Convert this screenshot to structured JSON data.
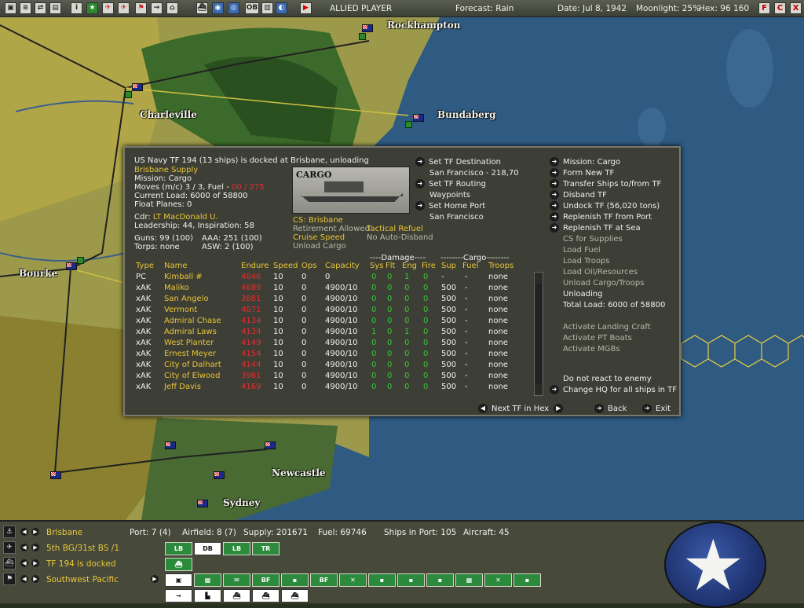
{
  "topbar": {
    "icons": [
      "save-icon",
      "report-icon",
      "swap-icon",
      "doc-icon",
      "info-icon",
      "star-icon",
      "plane-icon",
      "airplane-icon",
      "flag-icon",
      "transport-icon",
      "boat-icon",
      "ship-icon",
      "globe-icon",
      "globe2-icon",
      "ob-icon",
      "doc2-icon",
      "photo-icon",
      "play-icon"
    ],
    "ob_label": "OB",
    "side": "ALLIED PLAYER",
    "forecast": "Forecast: Rain",
    "date": "Date: Jul 8, 1942",
    "moonlight": "Moonlight: 25%",
    "hex": "Hex: 96 160",
    "right_buttons": [
      "F",
      "C",
      "X"
    ]
  },
  "map": {
    "cities": [
      "Rockhampton",
      "Charleville",
      "Bundaberg",
      "Bourke",
      "Newcastle",
      "Sydney"
    ]
  },
  "panel": {
    "title": "US Navy TF 194 (13 ships) is docked at Brisbane, unloading",
    "subtitle": "Brisbane Supply",
    "mission": "Mission: Cargo",
    "moves_prefix": "Moves (m/c) 3 / 3, Fuel - ",
    "moves_fuel": "00 / 275",
    "current_load": "Current Load: 6000 of 58800",
    "float_planes": "Float Planes: 0",
    "cdr_prefix": "Cdr: ",
    "cdr_name": "LT MacDonald U.",
    "leadership": "Leadership: 44, Inspiration: 58",
    "guns": "Guns: 99 (100)",
    "aaa": "AAA: 251 (100)",
    "torps": "Torps: none",
    "asw": "ASW: 2 (100)",
    "cargo_label": "CARGO",
    "cs": "CS: Brisbane",
    "retirement": "Retirement Allowed",
    "tactical_refuel": "Tactical Refuel",
    "cruise_speed": "Cruise Speed",
    "no_auto_disband": "No Auto-Disband",
    "unload_cargo": "Unload Cargo",
    "dest": {
      "set_dest": "Set TF Destination",
      "dest_val": "San Francisco - 218,70",
      "routing": "Set TF Routing",
      "waypoints": "Waypoints",
      "home_port": "Set Home Port",
      "home_val": "San Francisco"
    },
    "right_menu": {
      "mission": "Mission: Cargo",
      "form_new": "Form New TF",
      "transfer": "Transfer Ships to/from TF",
      "disband": "Disband TF",
      "undock": "Undock TF (56,020 tons)",
      "replenish_port": "Replenish TF from Port",
      "replenish_sea": "Replenish TF at Sea",
      "cs_supplies": "CS for Supplies",
      "load_fuel": "Load Fuel",
      "load_troops": "Load Troops",
      "load_oil": "Load Oil/Resources",
      "unload_troops": "Unload Cargo/Troops",
      "unloading": "Unloading",
      "total_load": "Total Load: 6000 of 58800",
      "landing_craft": "Activate Landing Craft",
      "pt_boats": "Activate PT Boats",
      "mgbs": "Activate MGBs",
      "no_react": "Do not react to enemy",
      "change_hq": "Change HQ for all ships in TF"
    },
    "nav": {
      "next_tf": "Next TF in Hex",
      "back": "Back",
      "exit": "Exit"
    },
    "table": {
      "damage_header": "----Damage----",
      "cargo_header": "--------Cargo--------",
      "columns": [
        "Type",
        "Name",
        "Endure",
        "Speed",
        "Ops",
        "Capacity",
        "Sys",
        "Flt",
        "Eng",
        "Fire",
        "Sup",
        "Fuel",
        "Troops"
      ],
      "rows": [
        {
          "type": "PC",
          "name": "Kimball #",
          "endure": "4846",
          "speed": "10",
          "ops": "0",
          "capacity": "0",
          "sys": "0",
          "flt": "0",
          "eng": "1",
          "fire": "0",
          "sup": "-",
          "fuel": "-",
          "troops": "none"
        },
        {
          "type": "xAK",
          "name": "Maliko",
          "endure": "4689",
          "speed": "10",
          "ops": "0",
          "capacity": "4900/10",
          "sys": "0",
          "flt": "0",
          "eng": "0",
          "fire": "0",
          "sup": "500",
          "fuel": "-",
          "troops": "none"
        },
        {
          "type": "xAK",
          "name": "San Angelo",
          "endure": "3881",
          "speed": "10",
          "ops": "0",
          "capacity": "4900/10",
          "sys": "0",
          "flt": "0",
          "eng": "0",
          "fire": "0",
          "sup": "500",
          "fuel": "-",
          "troops": "none"
        },
        {
          "type": "xAK",
          "name": "Vermont",
          "endure": "4871",
          "speed": "10",
          "ops": "0",
          "capacity": "4900/10",
          "sys": "0",
          "flt": "0",
          "eng": "0",
          "fire": "0",
          "sup": "500",
          "fuel": "-",
          "troops": "none"
        },
        {
          "type": "xAK",
          "name": "Admiral Chase",
          "endure": "4134",
          "speed": "10",
          "ops": "0",
          "capacity": "4900/10",
          "sys": "0",
          "flt": "0",
          "eng": "0",
          "fire": "0",
          "sup": "500",
          "fuel": "-",
          "troops": "none"
        },
        {
          "type": "xAK",
          "name": "Admiral Laws",
          "endure": "4134",
          "speed": "10",
          "ops": "0",
          "capacity": "4900/10",
          "sys": "1",
          "flt": "0",
          "eng": "1",
          "fire": "0",
          "sup": "500",
          "fuel": "-",
          "troops": "none"
        },
        {
          "type": "xAK",
          "name": "West Planter",
          "endure": "4149",
          "speed": "10",
          "ops": "0",
          "capacity": "4900/10",
          "sys": "0",
          "flt": "0",
          "eng": "0",
          "fire": "0",
          "sup": "500",
          "fuel": "-",
          "troops": "none"
        },
        {
          "type": "xAK",
          "name": "Ernest Meyer",
          "endure": "4154",
          "speed": "10",
          "ops": "0",
          "capacity": "4900/10",
          "sys": "0",
          "flt": "0",
          "eng": "0",
          "fire": "0",
          "sup": "500",
          "fuel": "-",
          "troops": "none"
        },
        {
          "type": "xAK",
          "name": "City of Dalhart",
          "endure": "4144",
          "speed": "10",
          "ops": "0",
          "capacity": "4900/10",
          "sys": "0",
          "flt": "0",
          "eng": "0",
          "fire": "0",
          "sup": "500",
          "fuel": "-",
          "troops": "none"
        },
        {
          "type": "xAK",
          "name": "City of Elwood",
          "endure": "3981",
          "speed": "10",
          "ops": "0",
          "capacity": "4900/10",
          "sys": "0",
          "flt": "0",
          "eng": "0",
          "fire": "0",
          "sup": "500",
          "fuel": "-",
          "troops": "none"
        },
        {
          "type": "xAK",
          "name": "Jeff Davis",
          "endure": "4169",
          "speed": "10",
          "ops": "0",
          "capacity": "4900/10",
          "sys": "0",
          "flt": "0",
          "eng": "0",
          "fire": "0",
          "sup": "500",
          "fuel": "-",
          "troops": "none"
        }
      ]
    }
  },
  "bottom": {
    "rows": [
      {
        "label": "Brisbane",
        "icon": "anchor-icon"
      },
      {
        "label": "5th BG/31st BS /1",
        "icon": "plane-icon"
      },
      {
        "label": "TF 194 is docked",
        "icon": "ship-icon"
      },
      {
        "label": "Southwest Pacific",
        "icon": "flag-icon"
      }
    ],
    "port": "Port: 7 (4)",
    "airfield": "Airfield: 8 (7)",
    "supply": "Supply: 201671",
    "fuel": "Fuel: 69746",
    "ships_in_port": "Ships in Port: 105",
    "aircraft": "Aircraft: 45",
    "row1_buttons": [
      "LB",
      "DB",
      "LB",
      "TR"
    ],
    "row3_buttons": [
      "",
      "",
      "",
      "BF",
      "",
      "BF",
      "",
      "",
      "",
      "",
      "",
      "",
      "",
      ""
    ],
    "emblem": "star-emblem"
  }
}
